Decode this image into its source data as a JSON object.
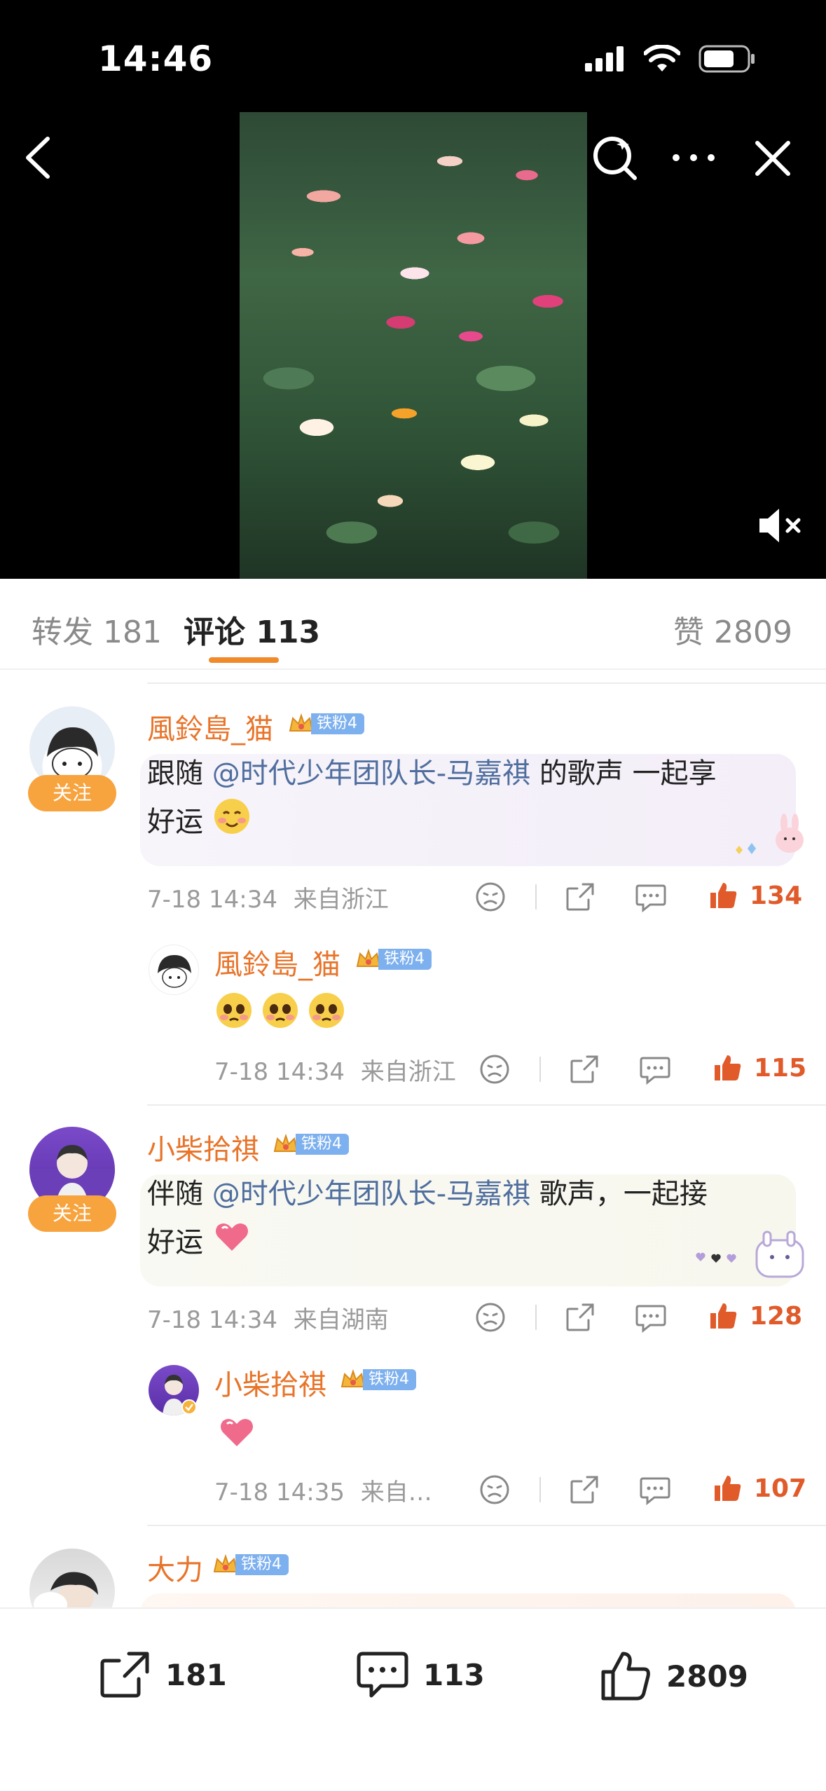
{
  "status_bar": {
    "time": "14:46"
  },
  "tabs": {
    "repost": "转发 181",
    "comments": "评论 113",
    "likes": "赞 2809"
  },
  "comments": [
    {
      "username": "風鈴島_猫",
      "fan_badge": "铁粉4",
      "follow": "关注",
      "text_before": "跟随 ",
      "mention": "@时代少年团队长-马嘉祺",
      "text_after": " 的歌声 一起享",
      "text_line2": "好运",
      "time": "7-18 14:34",
      "location": "来自浙江",
      "likes": "134",
      "reply": {
        "username": "風鈴島_猫",
        "fan_badge": "铁粉4",
        "time": "7-18 14:34",
        "location": "来自浙江",
        "likes": "115"
      }
    },
    {
      "username": "小柴拾祺",
      "fan_badge": "铁粉4",
      "follow": "关注",
      "text_before": "伴随 ",
      "mention": "@时代少年团队长-马嘉祺",
      "text_after": " 歌声，一起接",
      "text_line2": "好运",
      "time": "7-18 14:34",
      "location": "来自湖南",
      "likes": "128",
      "reply": {
        "username": "小柴拾祺",
        "fan_badge": "铁粉4",
        "time": "7-18 14:35",
        "location": "来自…",
        "likes": "107"
      }
    },
    {
      "username": "大力",
      "fan_badge": "铁粉4"
    }
  ],
  "bottom_bar": {
    "repost_count": "181",
    "comment_count": "113",
    "like_count": "2809"
  },
  "colors": {
    "accent_orange": "#f08a2a",
    "username_orange": "#e8742a",
    "like_red": "#e05a2a",
    "mention_blue": "#4f6e9e",
    "follow_button": "#f7a33e"
  }
}
